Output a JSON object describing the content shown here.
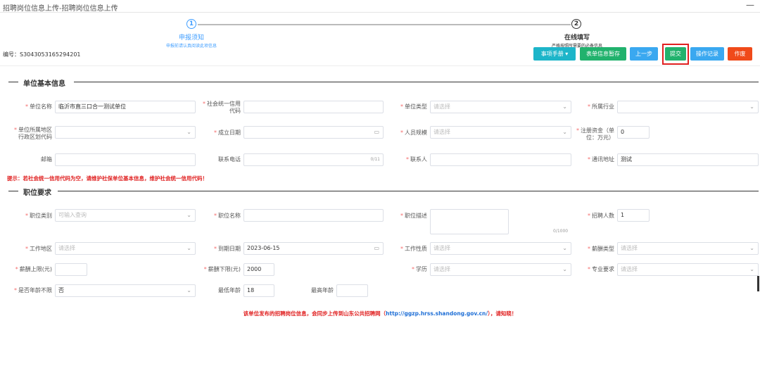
{
  "window": {
    "title": "招聘岗位信息上传-招聘岗位信息上传",
    "minimize": "—"
  },
  "steps": [
    {
      "num": "1",
      "title": "申报须知",
      "desc": "申报前请认真阅读此项信息"
    },
    {
      "num": "2",
      "title": "在线填写",
      "desc": "严格按照所需要的必备信息"
    }
  ],
  "serial": "编号：S3043053165294201",
  "toolbar": {
    "help": "事项手册 ▾",
    "save": "表单信息暂存",
    "prev": "上一步",
    "submit": "提交",
    "log": "操作记录",
    "void": "作废"
  },
  "section1": {
    "title": "单位基本信息"
  },
  "unit": {
    "name": {
      "label": "单位名称",
      "value": "临沂市直三口合一测试单位"
    },
    "credit_code": {
      "label1": "社会统一信用",
      "label2": "代码",
      "value": ""
    },
    "type": {
      "label": "单位类型",
      "placeholder": "请选择"
    },
    "industry": {
      "label": "所属行业",
      "placeholder": ""
    },
    "region": {
      "label1": "单位所属地区",
      "label2": "行政区划代码",
      "placeholder": ""
    },
    "founded": {
      "label": "成立日期",
      "value": ""
    },
    "staff_size": {
      "label": "人员规模",
      "placeholder": "请选择"
    },
    "capital": {
      "label1": "注册资金（单",
      "label2": "位：万元）",
      "value": "0"
    },
    "postcode": {
      "label": "邮箱",
      "value": ""
    },
    "phone": {
      "label": "联系电话",
      "counter": "0/11"
    },
    "contact": {
      "label": "联系人",
      "value": ""
    },
    "address": {
      "label": "通讯地址",
      "value": "测试"
    }
  },
  "warning": "提示：若社会统一信用代码为空，请维护社保单位基本信息，维护社会统一信用代码！",
  "section2": {
    "title": "职位要求"
  },
  "job": {
    "category": {
      "label": "职位类别",
      "placeholder": "可输入查询"
    },
    "name": {
      "label": "职位名称",
      "value": ""
    },
    "description": {
      "label": "职位描述",
      "counter": "0/1000"
    },
    "headcount": {
      "label": "招聘人数",
      "value": "1"
    },
    "area": {
      "label": "工作地区",
      "placeholder": "请选择"
    },
    "deadline": {
      "label": "到期日期",
      "value": "2023-06-15"
    },
    "nature": {
      "label": "工作性质",
      "placeholder": "请选择"
    },
    "salary_type": {
      "label": "薪酬类型",
      "placeholder": "请选择"
    },
    "salary_max": {
      "label": "薪酬上限(元)",
      "value": ""
    },
    "salary_min": {
      "label": "薪酬下限(元)",
      "value": "2000"
    },
    "education": {
      "label": "学历",
      "placeholder": "请选择"
    },
    "major": {
      "label": "专业要求",
      "placeholder": "请选择"
    },
    "age_unlimited": {
      "label": "是否年龄不限",
      "value": "否"
    },
    "age_min": {
      "label": "最低年龄",
      "value": "18"
    },
    "age_max": {
      "label": "最高年龄",
      "value": ""
    }
  },
  "notice": {
    "text1": "该单位发布的招聘岗位信息，会同步上传到山东公共招聘网（",
    "url": "http://ggzp.hrss.shandong.gov.cn/",
    "text2": "），请知晓！"
  },
  "colors": {
    "primary": "#409eff",
    "green": "#21b26d",
    "red": "#e02020",
    "orange": "#f04a1a",
    "teal": "#1db5c9"
  }
}
